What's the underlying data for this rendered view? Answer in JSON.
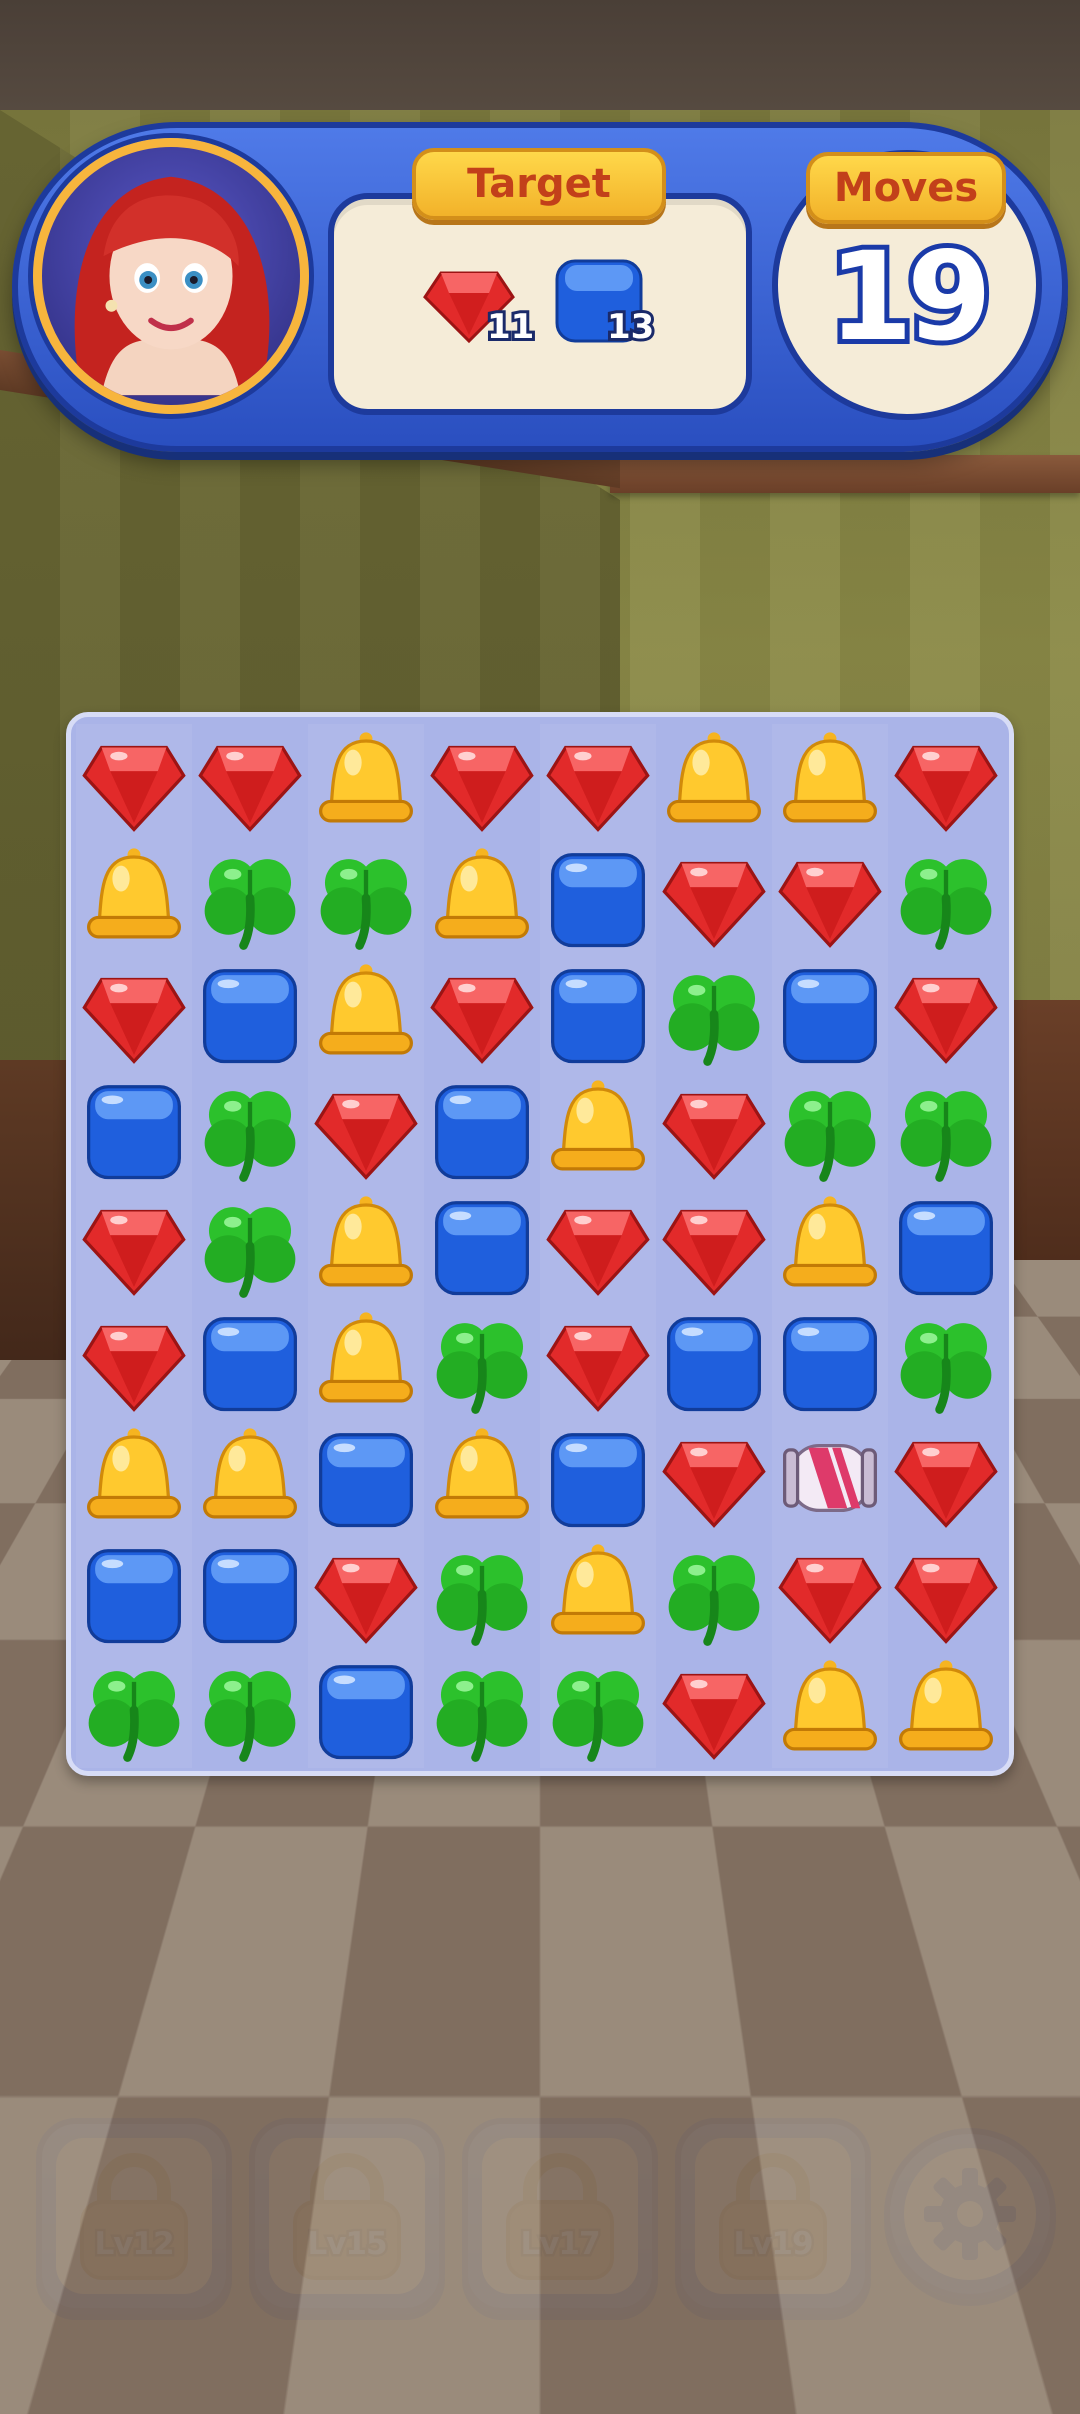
{
  "hud": {
    "target_label": "Target",
    "moves_label": "Moves",
    "moves_value": "19",
    "targets": [
      {
        "piece": "red-gem",
        "count": "11"
      },
      {
        "piece": "blue-cube",
        "count": "13"
      }
    ]
  },
  "board": {
    "columns": 8,
    "rows": [
      [
        "red",
        "red",
        "yellow",
        "red",
        "red",
        "yellow",
        "yellow",
        "red"
      ],
      [
        "yellow",
        "green",
        "green",
        "yellow",
        "blue",
        "red",
        "red",
        "green"
      ],
      [
        "red",
        "blue",
        "yellow",
        "red",
        "blue",
        "green",
        "blue",
        "red"
      ],
      [
        "blue",
        "green",
        "red",
        "blue",
        "yellow",
        "red",
        "green",
        "green"
      ],
      [
        "red",
        "green",
        "yellow",
        "blue",
        "red",
        "red",
        "yellow",
        "blue"
      ],
      [
        "red",
        "blue",
        "yellow",
        "green",
        "red",
        "blue",
        "blue",
        "green"
      ],
      [
        "yellow",
        "yellow",
        "blue",
        "yellow",
        "blue",
        "red",
        "rocket",
        "red"
      ],
      [
        "blue",
        "blue",
        "red",
        "green",
        "yellow",
        "green",
        "red",
        "red"
      ],
      [
        "green",
        "green",
        "blue",
        "green",
        "green",
        "red",
        "yellow",
        "yellow"
      ]
    ],
    "piece_icons": {
      "red": "red-gem-icon",
      "yellow": "yellow-bell-icon",
      "green": "green-clover-icon",
      "blue": "blue-cube-icon",
      "rocket": "striped-rocket-icon"
    }
  },
  "boosters": [
    {
      "label": "Lv12",
      "icon": "lock-icon"
    },
    {
      "label": "Lv15",
      "icon": "lock-icon"
    },
    {
      "label": "Lv17",
      "icon": "lock-icon"
    },
    {
      "label": "Lv19",
      "icon": "lock-icon"
    }
  ],
  "settings": {
    "icon": "gear-icon"
  },
  "colors": {
    "hud_blue": "#2a4fc0",
    "panel_cream": "#f5ecd8",
    "pill_gold": "#f2b22a",
    "board_lavender": "#aab4e8"
  }
}
